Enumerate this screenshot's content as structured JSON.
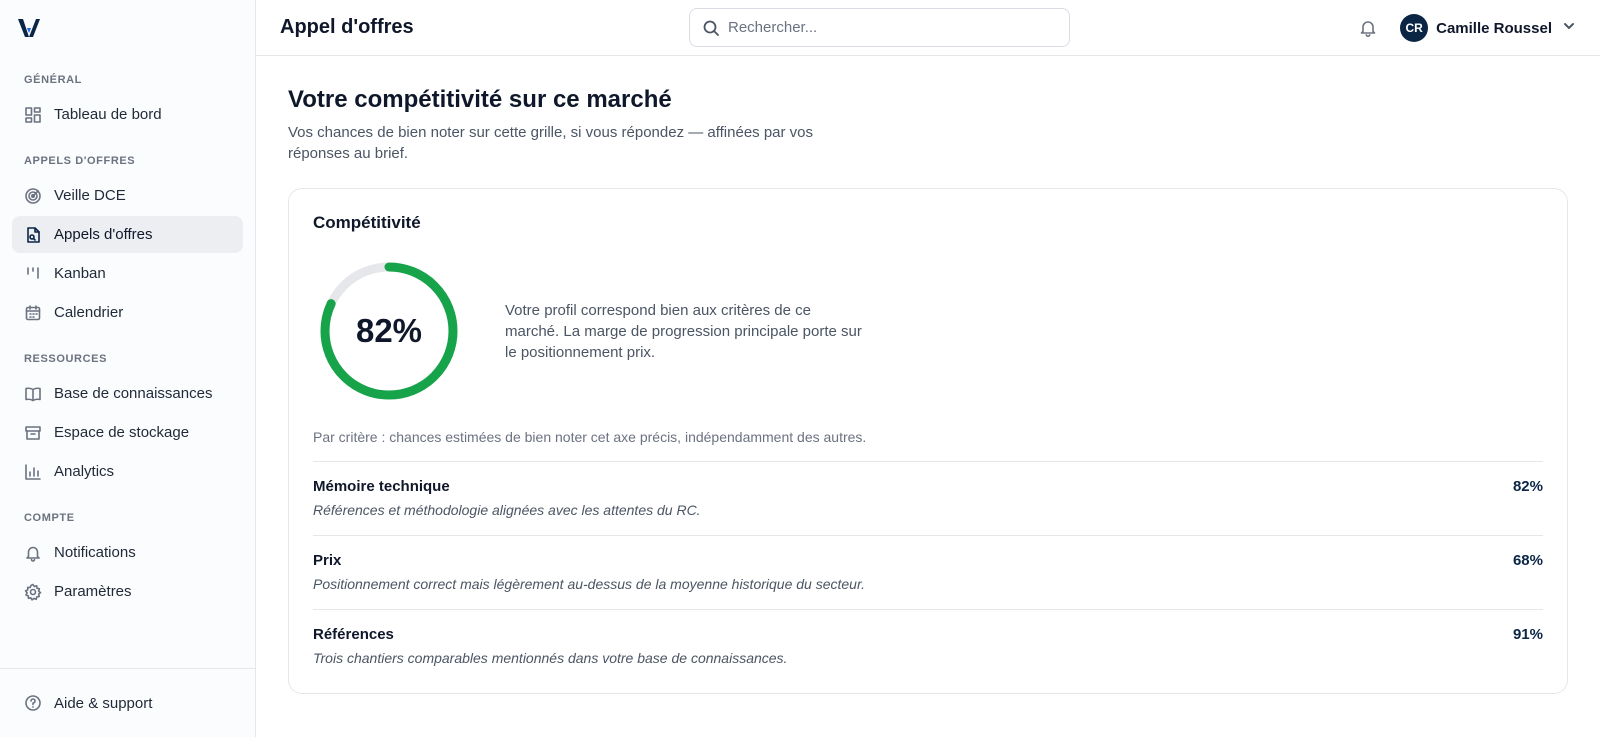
{
  "app": {
    "logo_icon": "vertice-logo-icon"
  },
  "sidebar": {
    "sections": [
      {
        "label": "GÉNÉRAL",
        "items": [
          {
            "label": "Tableau de bord",
            "icon": "dashboard-icon"
          }
        ]
      },
      {
        "label": "APPELS D'OFFRES",
        "items": [
          {
            "label": "Veille DCE",
            "icon": "radar-icon"
          },
          {
            "label": "Appels d'offres",
            "icon": "document-icon",
            "active": true
          },
          {
            "label": "Kanban",
            "icon": "kanban-icon"
          },
          {
            "label": "Calendrier",
            "icon": "calendar-icon"
          }
        ]
      },
      {
        "label": "RESSOURCES",
        "items": [
          {
            "label": "Base de connaissances",
            "icon": "book-icon"
          },
          {
            "label": "Espace de stockage",
            "icon": "archive-icon"
          },
          {
            "label": "Analytics",
            "icon": "bar-chart-icon"
          }
        ]
      },
      {
        "label": "COMPTE",
        "items": [
          {
            "label": "Notifications",
            "icon": "bell-icon"
          },
          {
            "label": "Paramètres",
            "icon": "gear-icon"
          }
        ]
      }
    ],
    "footer": {
      "label": "Aide & support",
      "icon": "help-circle-icon"
    }
  },
  "topbar": {
    "title": "Appel d'offres",
    "search_placeholder": "Rechercher...",
    "user": {
      "initials": "CR",
      "name": "Camille Roussel"
    }
  },
  "page": {
    "title": "Votre compétitivité sur ce marché",
    "subtitle": "Vos chances de bien noter sur cette grille, si vous répondez — affinées par vos réponses au brief."
  },
  "card": {
    "title": "Compétitivité",
    "score": 82,
    "score_label": "82%",
    "score_color": "#16a34a",
    "summary": "Votre profil correspond bien aux critères de ce marché. La marge de progression principale porte sur le positionnement prix.",
    "note": "Par critère : chances estimées de bien noter cet axe précis, indépendamment des autres.",
    "criteria": [
      {
        "name": "Mémoire technique",
        "desc": "Références et méthodologie alignées avec les attentes du RC.",
        "value": "82%"
      },
      {
        "name": "Prix",
        "desc": "Positionnement correct mais légèrement au-dessus de la moyenne historique du secteur.",
        "value": "68%"
      },
      {
        "name": "Références",
        "desc": "Trois chantiers comparables mentionnés dans votre base de connaissances.",
        "value": "91%"
      }
    ]
  }
}
